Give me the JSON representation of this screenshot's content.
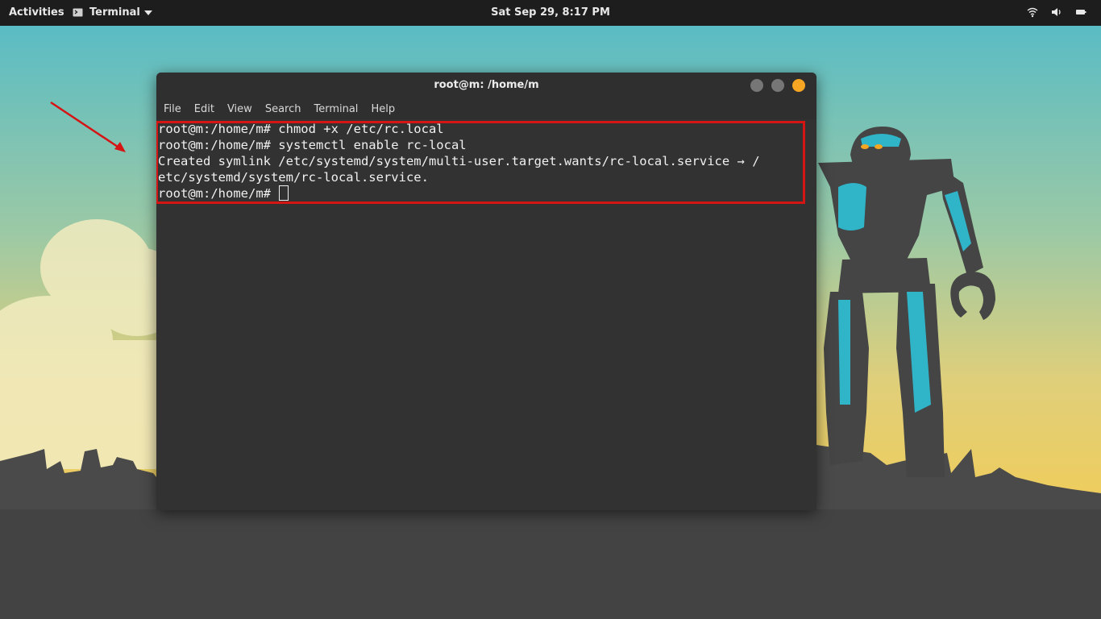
{
  "topbar": {
    "activities_label": "Activities",
    "app_menu_label": "Terminal",
    "clock": "Sat Sep 29,  8:17 PM",
    "tray_icons": [
      "wifi-icon",
      "volume-icon",
      "battery-icon"
    ]
  },
  "window": {
    "title": "root@m: /home/m",
    "menu": [
      "File",
      "Edit",
      "View",
      "Search",
      "Terminal",
      "Help"
    ],
    "controls": [
      "minimize",
      "maximize",
      "close"
    ]
  },
  "terminal": {
    "lines": [
      "root@m:/home/m# chmod +x /etc/rc.local",
      "root@m:/home/m# systemctl enable rc-local",
      "Created symlink /etc/systemd/system/multi-user.target.wants/rc-local.service → /",
      "etc/systemd/system/rc-local.service.",
      "root@m:/home/m# "
    ]
  },
  "colors": {
    "topbar": "#1d1d1d",
    "terminal_bg": "#323232",
    "close_button": "#f6a623",
    "highlight": "#d51414",
    "robot_cyan": "#2fb4c8",
    "sky_top": "#5cbcc2",
    "sky_bottom": "#f2cf5b"
  }
}
